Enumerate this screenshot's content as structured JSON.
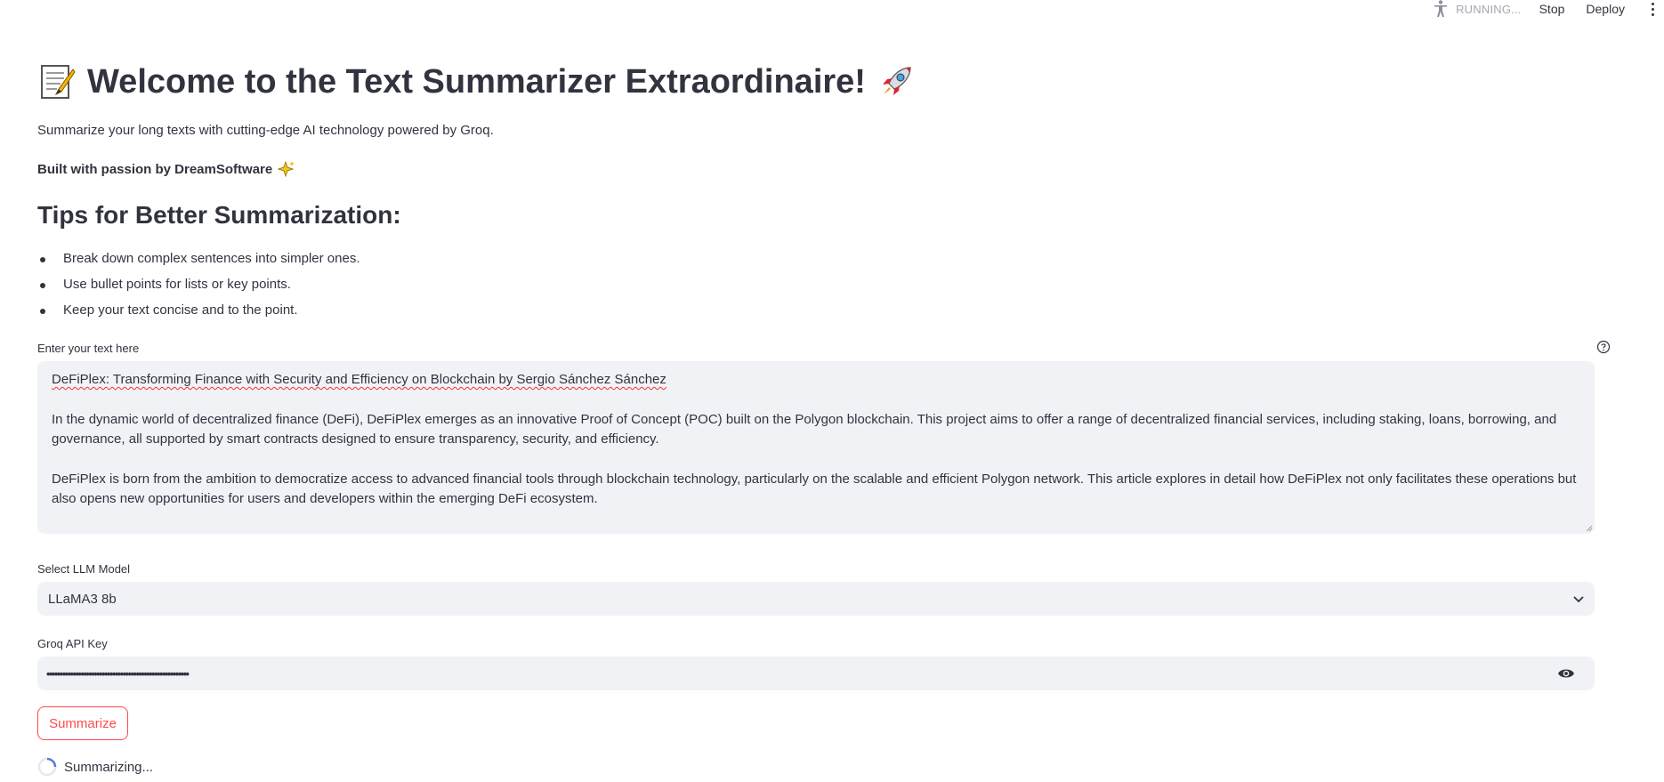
{
  "toolbar": {
    "status": "RUNNING...",
    "stop_label": "Stop",
    "deploy_label": "Deploy"
  },
  "header": {
    "title": "Welcome to the Text Summarizer Extraordinaire!",
    "subtitle": "Summarize your long texts with cutting-edge AI technology powered by Groq.",
    "built_by": "Built with passion by DreamSoftware"
  },
  "tips": {
    "title": "Tips for Better Summarization:",
    "items": [
      "Break down complex sentences into simpler ones.",
      "Use bullet points for lists or key points.",
      "Keep your text concise and to the point."
    ]
  },
  "text_input": {
    "label": "Enter your text here",
    "paragraphs": [
      "DeFiPlex: Transforming Finance with Security and Efficiency on Blockchain by Sergio Sánchez Sánchez",
      "In the dynamic world of decentralized finance (DeFi), DeFiPlex emerges as an innovative Proof of Concept (POC) built on the Polygon blockchain. This project aims to offer a range of decentralized financial services, including staking, loans, borrowing, and governance, all supported by smart contracts designed to ensure transparency, security, and efficiency.",
      "DeFiPlex is born from the ambition to democratize access to advanced financial tools through blockchain technology, particularly on the scalable and efficient Polygon network. This article explores in detail how DeFiPlex not only facilitates these operations but also opens new opportunities for users and developers within the emerging DeFi ecosystem."
    ]
  },
  "model_select": {
    "label": "Select LLM Model",
    "value": "LLaMA3 8b"
  },
  "api_key": {
    "label": "Groq API Key",
    "masked_value": "••••••••••••••••••••••••••••••••••••••••••••••••••••••"
  },
  "actions": {
    "summarize_label": "Summarize",
    "status": "Summarizing..."
  },
  "colors": {
    "accent": "#ff4b4b",
    "text": "#31333f",
    "input_bg": "#f0f2f6"
  }
}
